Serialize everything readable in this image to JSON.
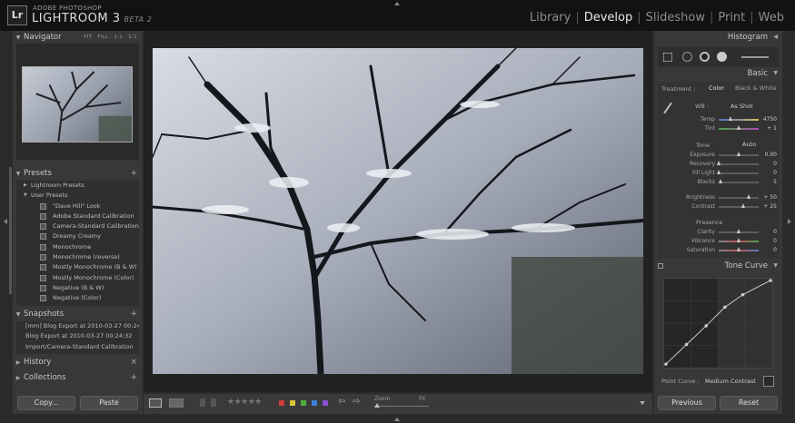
{
  "app": {
    "logo": "Lr",
    "brand_small": "ADOBE PHOTOSHOP",
    "brand_name": "LIGHTROOM 3",
    "brand_beta": "BETA 2"
  },
  "modules": [
    {
      "label": "Library",
      "active": false
    },
    {
      "label": "Develop",
      "active": true
    },
    {
      "label": "Slideshow",
      "active": false
    },
    {
      "label": "Print",
      "active": false
    },
    {
      "label": "Web",
      "active": false
    }
  ],
  "navigator": {
    "title": "Navigator",
    "zoom_options": "FIT FILL 1:1 1:1"
  },
  "presets": {
    "title": "Presets",
    "add": "+",
    "folders": [
      {
        "label": "Lightroom Presets",
        "expanded": false
      },
      {
        "label": "User Presets",
        "expanded": true
      }
    ],
    "items": [
      "\"Dave Hill\" Look",
      "Adobe Standard Calibration",
      "Camera-Standard Calibration",
      "Dreamy Creamy",
      "Monochrome",
      "Monochrome (reverse)",
      "Mostly Monochrome (B & W)",
      "Mostly Monochrome (Color)",
      "Negative (B & W)",
      "Negative (Color)"
    ]
  },
  "snapshots": {
    "title": "Snapshots",
    "add": "+",
    "items": [
      "[mm] Blog Export at 2010-03-27 00:24:36",
      "Blog Export at 2010-03-27 00:24:32",
      "Import/Camera-Standard Calibration"
    ]
  },
  "history": {
    "title": "History",
    "action": "×"
  },
  "collections": {
    "title": "Collections",
    "action": "+"
  },
  "left_buttons": {
    "copy": "Copy...",
    "paste": "Paste"
  },
  "toolbar": {
    "rating_stars": "★★★★★",
    "zoom_label": "Zoom",
    "fit_label": "Fit",
    "zoom_level": 0.05,
    "color_labels": [
      "#d33b3b",
      "#d8c237",
      "#4fae3b",
      "#3d7fd6",
      "#8a4fd3"
    ]
  },
  "right_panel": {
    "histogram": {
      "title": "Histogram"
    },
    "basic": {
      "title": "Basic",
      "treatment_label": "Treatment :",
      "treatment_color": "Color",
      "treatment_bw": "Black & White",
      "wb_label": "WB :",
      "wb_value": "As Shot",
      "tone_label": "Tone",
      "tone_auto": "Auto",
      "presence_label": "Presence",
      "sliders_wb": [
        {
          "label": "Temp",
          "value": "4750",
          "position": 0.3
        },
        {
          "label": "Tint",
          "value": "+ 1",
          "position": 0.5
        }
      ],
      "sliders_tone": [
        {
          "label": "Exposure",
          "value": "0.00",
          "position": 0.5
        },
        {
          "label": "Recovery",
          "value": "0",
          "position": 0.02
        },
        {
          "label": "Fill Light",
          "value": "0",
          "position": 0.02
        },
        {
          "label": "Blacks",
          "value": "5",
          "position": 0.05
        },
        {
          "label": "Brightness",
          "value": "+ 50",
          "position": 0.75
        },
        {
          "label": "Contrast",
          "value": "+ 25",
          "position": 0.62
        }
      ],
      "sliders_presence": [
        {
          "label": "Clarity",
          "value": "0",
          "position": 0.5
        },
        {
          "label": "Vibrance",
          "value": "0",
          "position": 0.5
        },
        {
          "label": "Saturation",
          "value": "0",
          "position": 0.5
        }
      ]
    },
    "tone_curve": {
      "title": "Tone Curve",
      "point_curve_label": "Point Curve :",
      "point_curve_value": "Medium Contrast"
    },
    "buttons": {
      "previous": "Previous",
      "reset": "Reset"
    }
  }
}
